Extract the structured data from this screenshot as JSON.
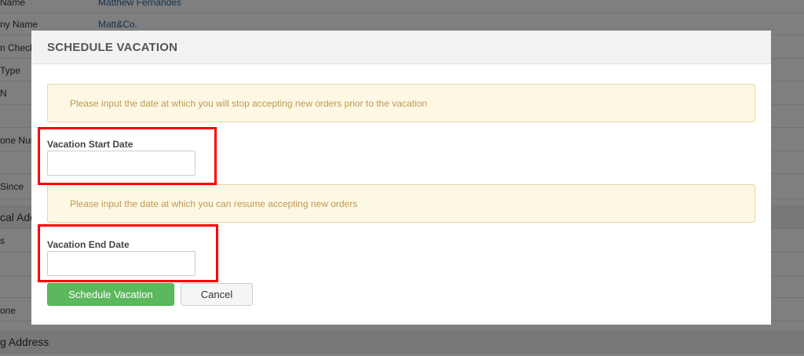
{
  "background": {
    "rows": [
      {
        "label": "Name",
        "value": "Matthew Fernandes"
      },
      {
        "label": "ny Name",
        "value": "Matt&Co."
      },
      {
        "label": "n Check",
        "value": ""
      },
      {
        "label": "Type",
        "value": ""
      },
      {
        "label": "N",
        "value": ""
      },
      {
        "label": "",
        "value": ""
      },
      {
        "label": "one Nun",
        "value": ""
      },
      {
        "label": "",
        "value": ""
      },
      {
        "label": "Since",
        "value": ""
      },
      {
        "label": "cal Add",
        "value": ""
      },
      {
        "label": "s",
        "value": ""
      },
      {
        "label": "",
        "value": ""
      },
      {
        "label": "",
        "value": ""
      },
      {
        "label": "one",
        "value": ""
      },
      {
        "label": "g Address",
        "value": ""
      }
    ]
  },
  "modal": {
    "title": "SCHEDULE VACATION",
    "start_notice": "Please input the date at which you will stop accepting new orders prior to the vacation",
    "start_label": "Vacation Start Date",
    "start_value": "",
    "end_notice": "Please input the date at which you can resume accepting new orders",
    "end_label": "Vacation End Date",
    "end_value": "",
    "schedule_button": "Schedule Vacation",
    "cancel_button": "Cancel"
  },
  "colors": {
    "primary_button": "#5cb85c",
    "notice_bg": "#fcf8e3",
    "notice_text": "#c09853",
    "highlight": "#ff0000"
  }
}
